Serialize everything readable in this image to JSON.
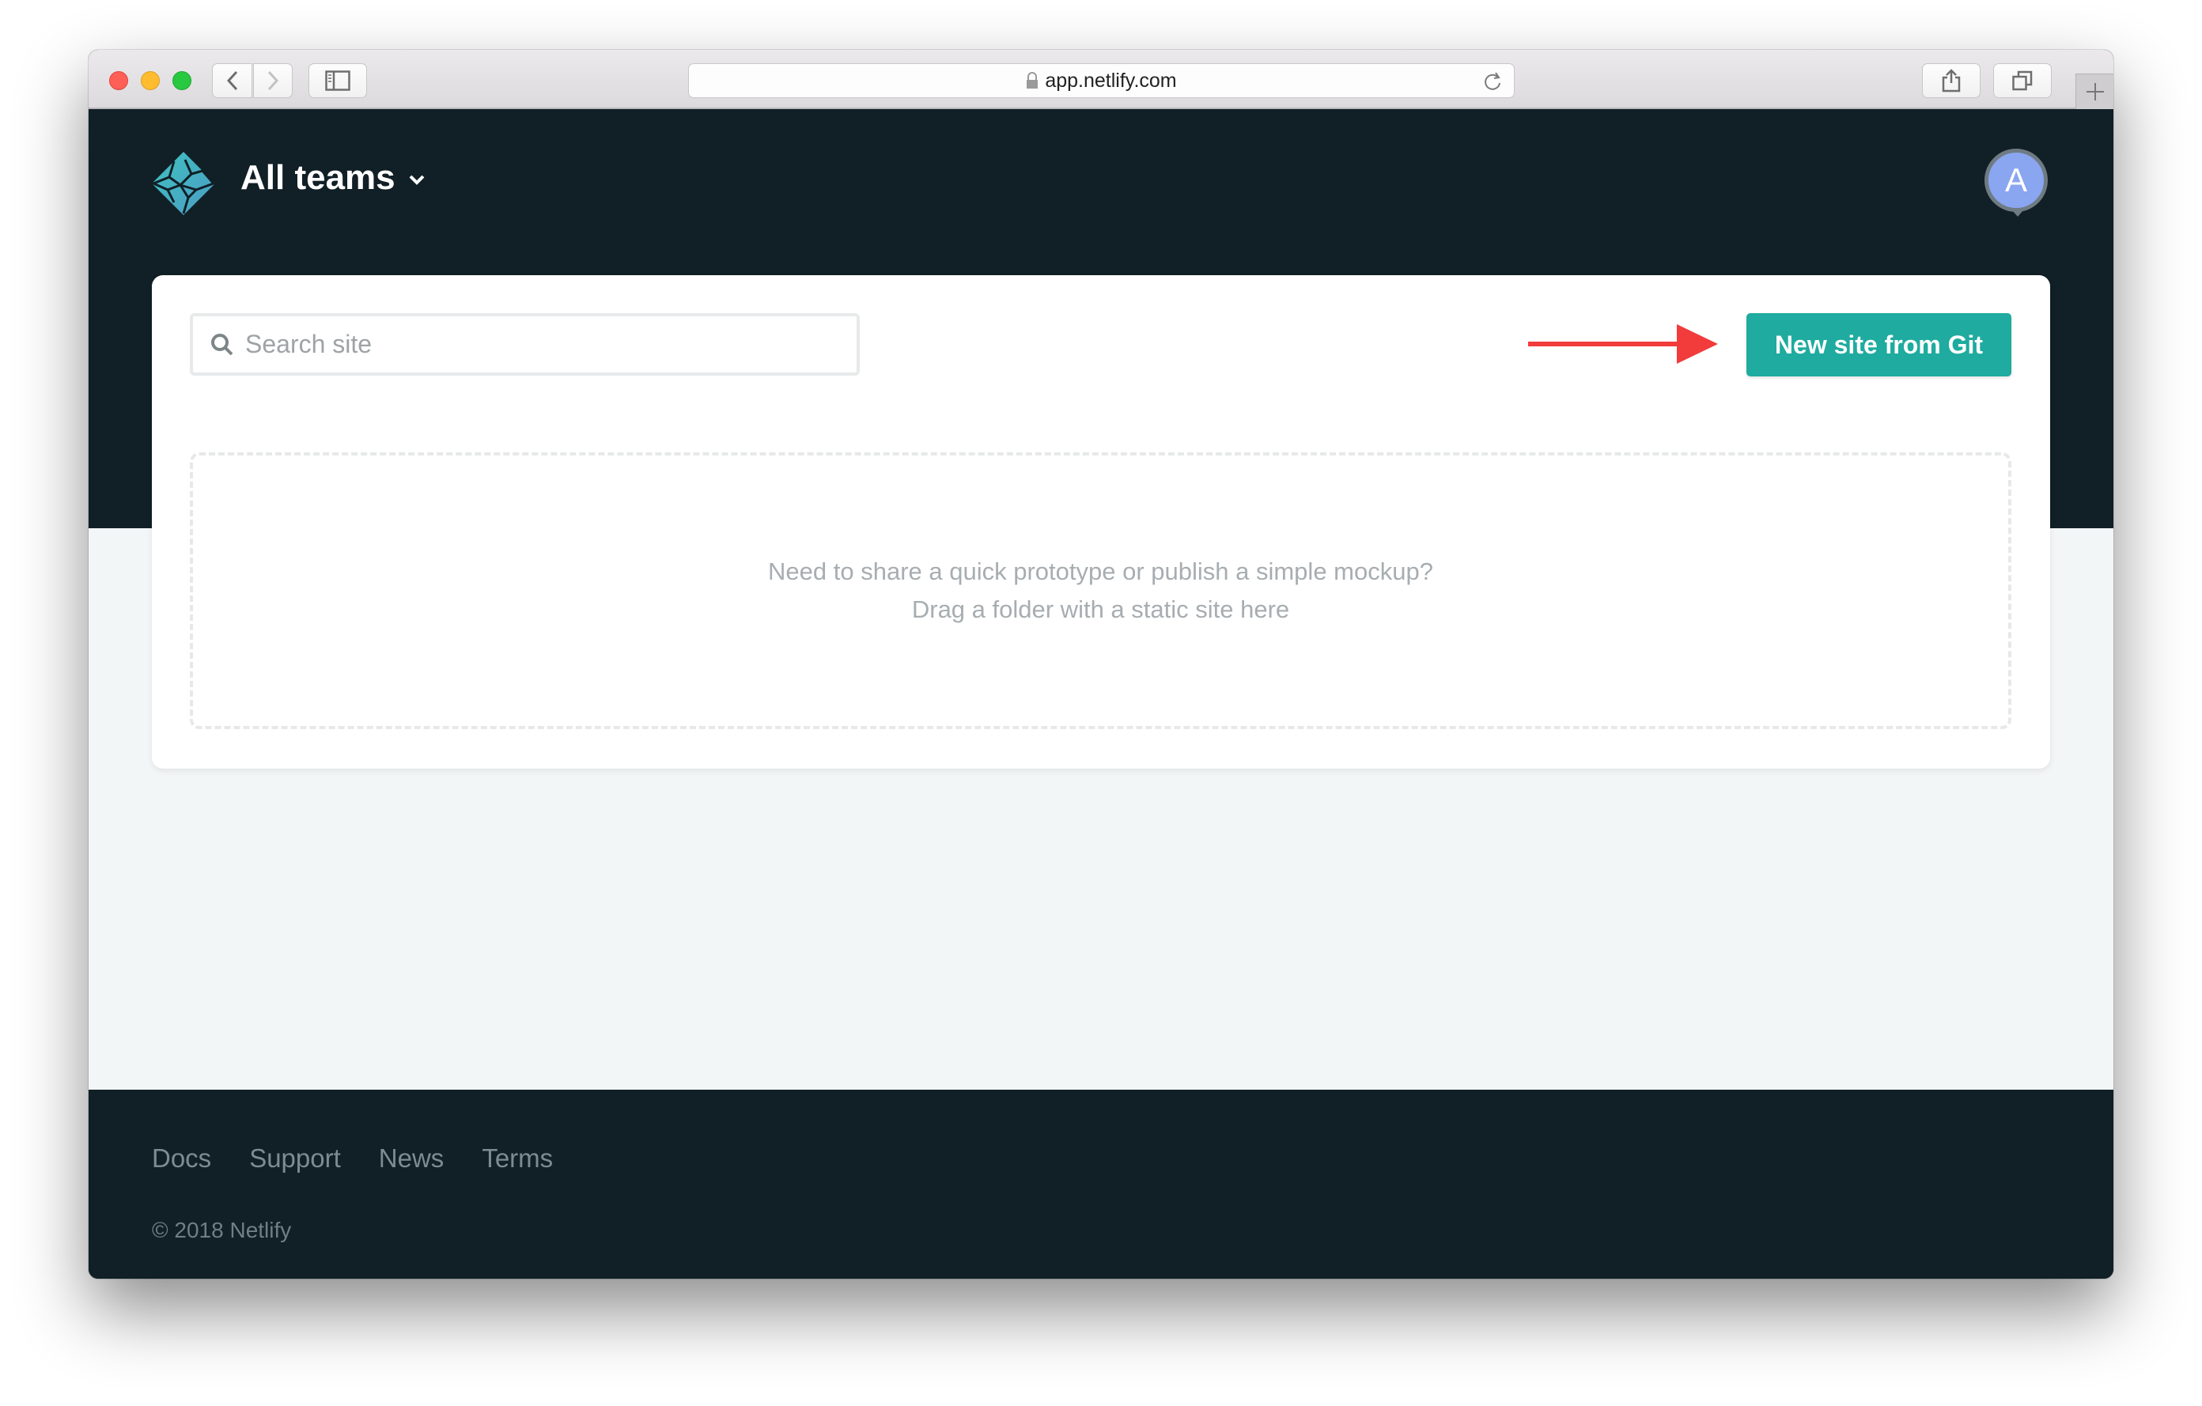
{
  "browser": {
    "url": "app.netlify.com",
    "traffic_lights": [
      "close",
      "minimize",
      "zoom"
    ],
    "buttons": {
      "back": "chevron-left-icon",
      "forward": "chevron-right-icon",
      "sidebar": "sidebar-icon",
      "reload": "reload-icon",
      "share": "share-icon",
      "tabs": "tabs-icon",
      "new_tab": "plus-icon"
    }
  },
  "header": {
    "logo": "netlify-logo",
    "team_label": "All teams",
    "avatar_initial": "A",
    "avatar_color": "#8aa6f1"
  },
  "main": {
    "search_placeholder": "Search site",
    "search_value": "",
    "new_site_button": "New site from Git",
    "accent_color": "#1fab9f",
    "annotation_arrow_color": "#f23b3b",
    "dropzone": {
      "line1": "Need to share a quick prototype or publish a simple mockup?",
      "line2": "Drag a folder with a static site here"
    }
  },
  "footer": {
    "links": [
      {
        "label": "Docs"
      },
      {
        "label": "Support"
      },
      {
        "label": "News"
      },
      {
        "label": "Terms"
      }
    ],
    "copyright": "© 2018 Netlify"
  }
}
